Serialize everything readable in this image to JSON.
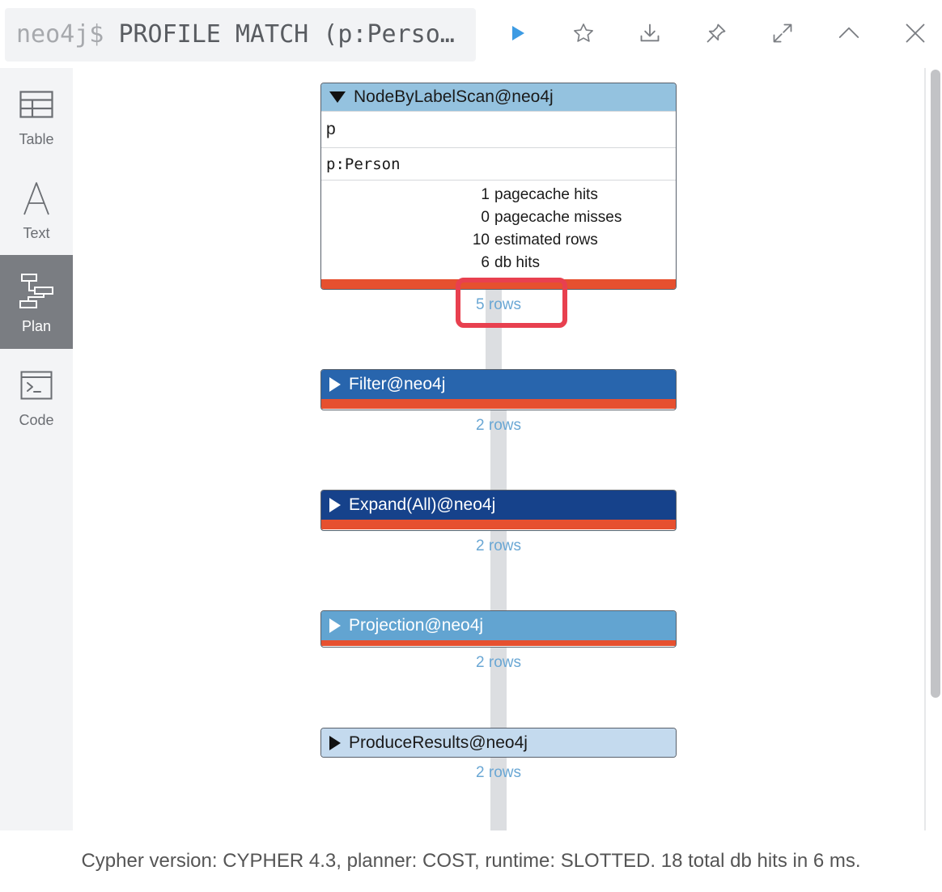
{
  "header": {
    "prompt": "neo4j$",
    "query": "PROFILE MATCH (p:Perso…",
    "buttons": [
      "run-icon",
      "favorite-star-icon",
      "download-icon",
      "pin-icon",
      "fullscreen-icon",
      "collapse-icon",
      "close-icon"
    ]
  },
  "sidebar": {
    "items": [
      {
        "label": "Table",
        "icon": "table-icon",
        "active": false
      },
      {
        "label": "Text",
        "icon": "text-icon",
        "active": false
      },
      {
        "label": "Plan",
        "icon": "plan-icon",
        "active": true
      },
      {
        "label": "Code",
        "icon": "code-icon",
        "active": false
      }
    ]
  },
  "plan": {
    "operators": [
      {
        "name": "NodeByLabelScan@neo4j",
        "expanded": true,
        "header_color": "#94c2df",
        "identifier": "p",
        "details": "p:Person",
        "stats": [
          {
            "value": "1",
            "label": "pagecache hits"
          },
          {
            "value": "0",
            "label": "pagecache misses"
          },
          {
            "value": "10",
            "label": "estimated rows"
          },
          {
            "value": "6",
            "label": "db hits"
          }
        ],
        "rows": "5 rows"
      },
      {
        "name": "Filter@neo4j",
        "expanded": false,
        "header_color": "#2865ad",
        "rows": "2 rows"
      },
      {
        "name": "Expand(All)@neo4j",
        "expanded": false,
        "header_color": "#16428b",
        "rows": "2 rows"
      },
      {
        "name": "Projection@neo4j",
        "expanded": false,
        "header_color": "#62a4d1",
        "rows": "2 rows"
      },
      {
        "name": "ProduceResults@neo4j",
        "expanded": false,
        "header_color": "#c4daee",
        "rows": "2 rows"
      }
    ]
  },
  "footer": {
    "text": "Cypher version: CYPHER 4.3, planner: COST, runtime: SLOTTED. 18 total db hits in 6 ms."
  },
  "colors": {
    "accent_run": "#3d9be3",
    "cost_bar": "#e6502f",
    "highlight": "#e8404f",
    "rows_text": "#6aa7d4"
  }
}
